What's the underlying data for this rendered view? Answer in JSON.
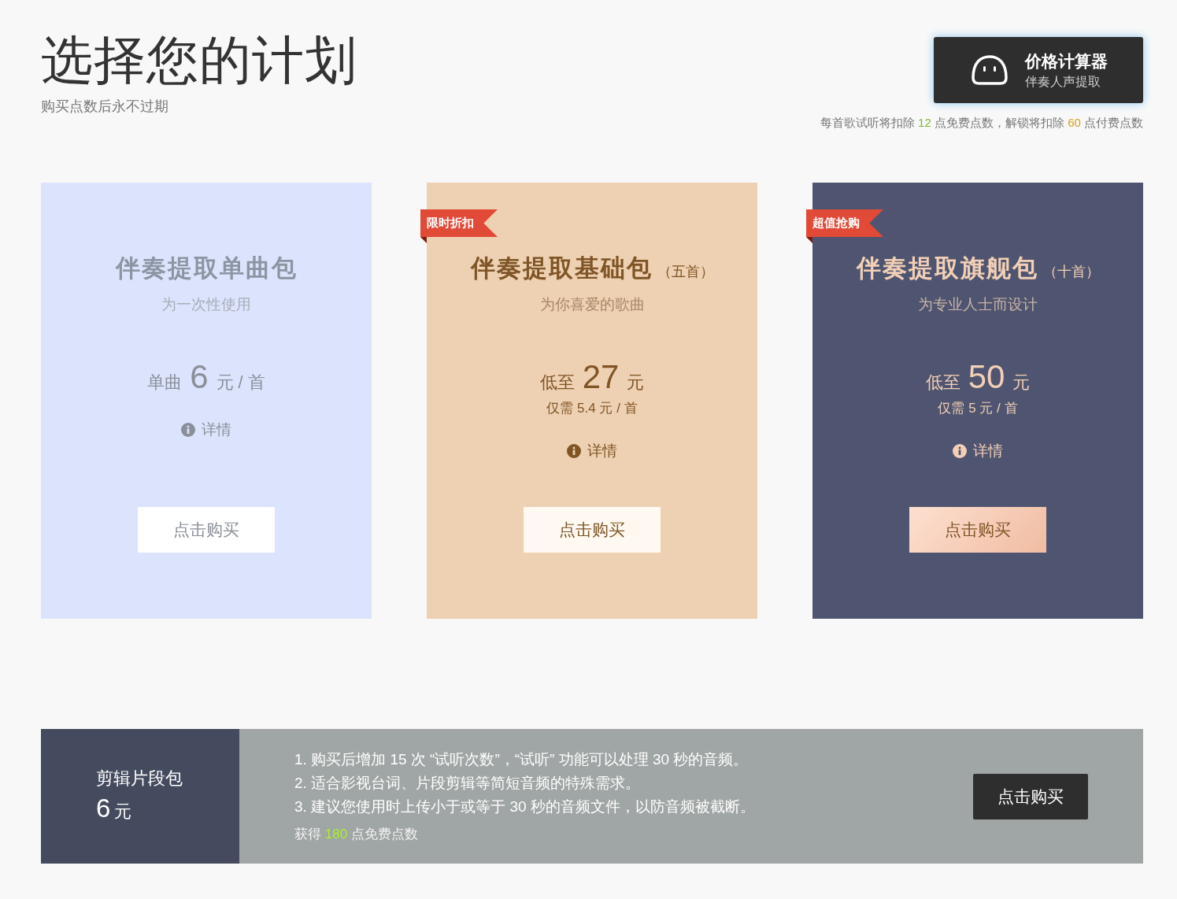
{
  "header": {
    "title": "选择您的计划",
    "subtitle": "购买点数后永不过期"
  },
  "calculator": {
    "title": "价格计算器",
    "subtitle": "伴奏人声提取"
  },
  "points_note": {
    "before": "每首歌试听将扣除",
    "free_points": "12",
    "middle": "点免费点数，解锁将扣除",
    "paid_points": "60",
    "after": "点付费点数"
  },
  "plans": [
    {
      "kind": "light",
      "title": "伴奏提取单曲包",
      "subtitle": "为一次性使用",
      "price": {
        "prefix": "单曲",
        "amount": "6",
        "unit": "元 / 首"
      },
      "details": "详情",
      "button": "点击购买"
    },
    {
      "kind": "tan",
      "ribbon": "限时折扣",
      "title": "伴奏提取基础包",
      "count": "（五首）",
      "subtitle": "为你喜爱的歌曲",
      "price": {
        "prefix": "低至",
        "amount": "27",
        "unit": "元"
      },
      "per_song": "仅需 5.4 元 / 首",
      "details": "详情",
      "button": "点击购买"
    },
    {
      "kind": "dark",
      "ribbon": "超值抢购",
      "title": "伴奏提取旗舰包",
      "count": "（十首）",
      "subtitle": "为专业人士而设计",
      "price": {
        "prefix": "低至",
        "amount": "50",
        "unit": "元"
      },
      "per_song": "仅需 5 元 / 首",
      "details": "详情",
      "button": "点击购买"
    }
  ],
  "clip_pack": {
    "title": "剪辑片段包",
    "amount": "6",
    "unit": "元",
    "lines": [
      "1. 购买后增加 15 次 “试听次数”，“试听” 功能可以处理 30 秒的音频。",
      "2. 适合影视台词、片段剪辑等简短音频的特殊需求。",
      "3. 建议您使用时上传小于或等于 30 秒的音频文件，以防音频被截断。"
    ],
    "bonus": {
      "before": "获得",
      "points": "180",
      "after": "点免费点数"
    },
    "button": "点击购买"
  }
}
